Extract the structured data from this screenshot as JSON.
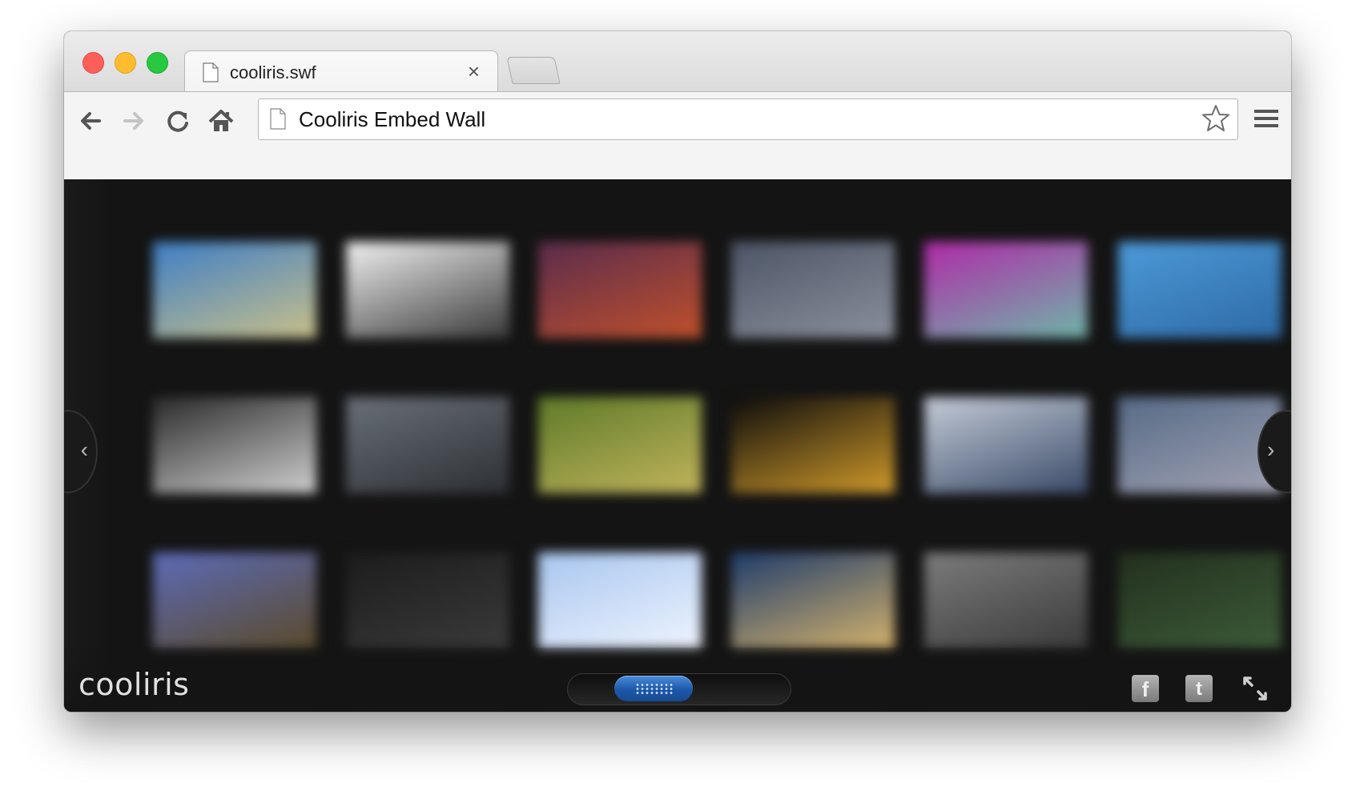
{
  "browser": {
    "tab": {
      "title": "cooliris.swf",
      "close_glyph": "×"
    },
    "omnibox": {
      "title": "Cooliris Embed Wall"
    },
    "toolbar_icons": [
      "back-icon",
      "forward-icon",
      "reload-icon",
      "home-icon",
      "star-icon",
      "menu-icon"
    ]
  },
  "wall": {
    "logo": "cooliris",
    "nav": {
      "prev": "‹",
      "next": "›"
    },
    "social": {
      "facebook": "f",
      "twitter": "t"
    },
    "thumbnails": [
      {
        "colors": [
          "#3d7ec6",
          "#c9c08a"
        ]
      },
      {
        "colors": [
          "#f2f2f2",
          "#3a3a3a"
        ]
      },
      {
        "colors": [
          "#5a2c4c",
          "#c0502c"
        ]
      },
      {
        "colors": [
          "#4c5566",
          "#8a909c"
        ]
      },
      {
        "colors": [
          "#b02aa8",
          "#6fb5a8"
        ]
      },
      {
        "colors": [
          "#4c9ad8",
          "#2d6aa6"
        ]
      },
      {
        "colors": [
          "#2a2a2a",
          "#cfcfcf"
        ]
      },
      {
        "colors": [
          "#6a7078",
          "#2c3034"
        ]
      },
      {
        "colors": [
          "#5d7a28",
          "#c2b45c"
        ]
      },
      {
        "colors": [
          "#0c0c0c",
          "#d09a2a"
        ]
      },
      {
        "colors": [
          "#c4ccd8",
          "#3a4a68"
        ]
      },
      {
        "colors": [
          "#566a86",
          "#a0a2b2"
        ]
      },
      {
        "colors": [
          "#5c6bb8",
          "#5a4a2a"
        ]
      },
      {
        "colors": [
          "#1c1c1c",
          "#3a3a3a"
        ]
      },
      {
        "colors": [
          "#a8c6ee",
          "#eef4ff"
        ]
      },
      {
        "colors": [
          "#1e3c6c",
          "#d4b26c"
        ]
      },
      {
        "colors": [
          "#7c7c7c",
          "#3a3a3a"
        ]
      },
      {
        "colors": [
          "#23301e",
          "#3c5a38"
        ]
      }
    ]
  },
  "scrollbar": {
    "position": 0.32
  }
}
